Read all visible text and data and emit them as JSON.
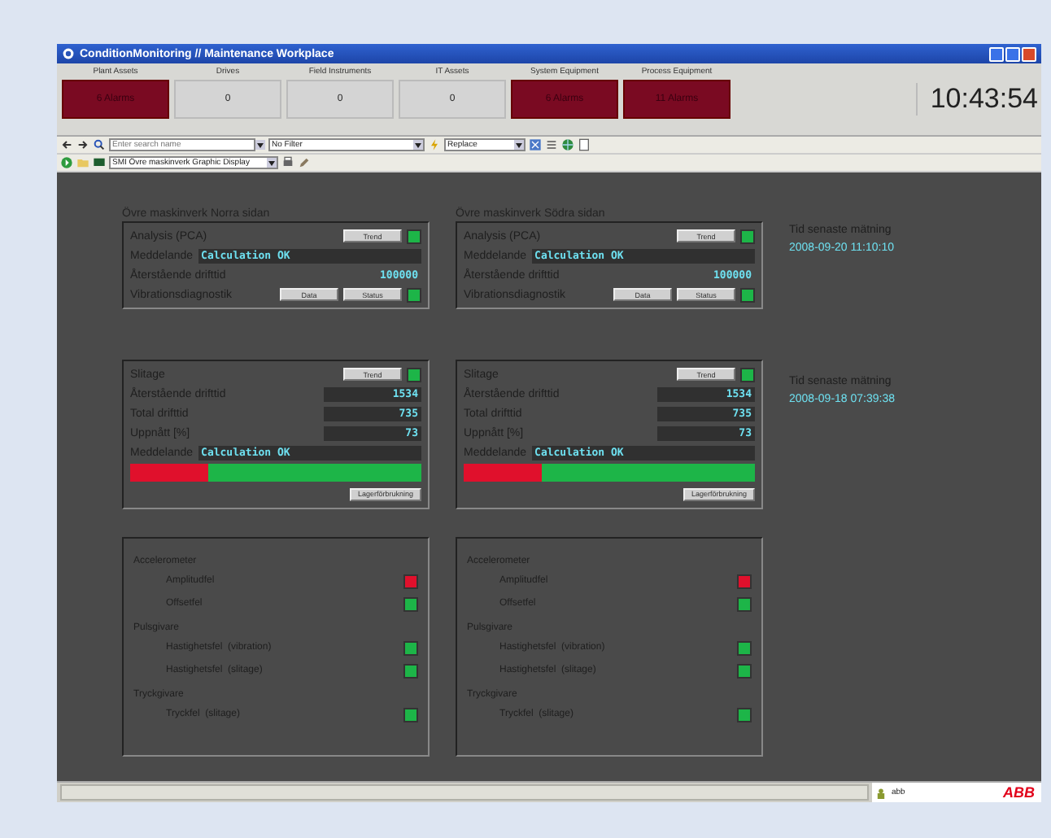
{
  "window": {
    "title": "ConditionMonitoring // Maintenance Workplace"
  },
  "categories": [
    {
      "label": "Plant Assets",
      "value": "6 Alarms",
      "alarm": true
    },
    {
      "label": "Drives",
      "value": "0",
      "alarm": false
    },
    {
      "label": "Field Instruments",
      "value": "0",
      "alarm": false
    },
    {
      "label": "IT Assets",
      "value": "0",
      "alarm": false
    },
    {
      "label": "System Equipment",
      "value": "6 Alarms",
      "alarm": true
    },
    {
      "label": "Process Equipment",
      "value": "11 Alarms",
      "alarm": true
    }
  ],
  "clock": "10:43:54",
  "toolbar": {
    "search_placeholder": "Enter search name",
    "filter": "No Filter",
    "mode": "Replace",
    "display": "SMI Övre maskinverk Graphic Display"
  },
  "sides": [
    {
      "title": "Övre maskinverk Norra sidan",
      "analysis_label": "Analysis (PCA)",
      "trend": "Trend",
      "analysis_ok": true,
      "message_label": "Meddelande",
      "message": "Calculation OK",
      "remaining_label": "Återstående drifttid",
      "remaining": "100000",
      "vibration_label": "Vibrationsdiagnostik",
      "data": "Data",
      "status": "Status",
      "vibration_ok": true,
      "wear": {
        "label": "Slitage",
        "trend": "Trend",
        "ok": true,
        "rows": [
          {
            "label": "Återstående drifttid",
            "value": "1534"
          },
          {
            "label": "Total drifttid",
            "value": "735"
          },
          {
            "label": "Uppnått [%]",
            "value": "73"
          }
        ],
        "message_label": "Meddelande",
        "message": "Calculation OK",
        "level": 0.27,
        "button": "Lagerförbrukning"
      },
      "sensors": [
        {
          "label": "Accelerometer",
          "children": [
            {
              "label": "Amplitudfel",
              "ok": false
            },
            {
              "label": "Offsetfel",
              "ok": true
            }
          ]
        },
        {
          "label": "Pulsgivare",
          "children": [
            {
              "label": "Hastighetsfel  (vibration)",
              "ok": true
            },
            {
              "label": "Hastighetsfel  (slitage)",
              "ok": true
            }
          ]
        },
        {
          "label": "Tryckgivare",
          "children": [
            {
              "label": "Tryckfel  (slitage)",
              "ok": true
            }
          ]
        }
      ]
    },
    {
      "title": "Övre maskinverk Södra sidan",
      "analysis_label": "Analysis (PCA)",
      "trend": "Trend",
      "analysis_ok": true,
      "message_label": "Meddelande",
      "message": "Calculation OK",
      "remaining_label": "Återstående drifttid",
      "remaining": "100000",
      "vibration_label": "Vibrationsdiagnostik",
      "data": "Data",
      "status": "Status",
      "vibration_ok": true,
      "wear": {
        "label": "Slitage",
        "trend": "Trend",
        "ok": true,
        "rows": [
          {
            "label": "Återstående drifttid",
            "value": "1534"
          },
          {
            "label": "Total drifttid",
            "value": "735"
          },
          {
            "label": "Uppnått [%]",
            "value": "73"
          }
        ],
        "message_label": "Meddelande",
        "message": "Calculation OK",
        "level": 0.27,
        "button": "Lagerförbrukning"
      },
      "sensors": [
        {
          "label": "Accelerometer",
          "children": [
            {
              "label": "Amplitudfel",
              "ok": false
            },
            {
              "label": "Offsetfel",
              "ok": true
            }
          ]
        },
        {
          "label": "Pulsgivare",
          "children": [
            {
              "label": "Hastighetsfel  (vibration)",
              "ok": true
            },
            {
              "label": "Hastighetsfel  (slitage)",
              "ok": true
            }
          ]
        },
        {
          "label": "Tryckgivare",
          "children": [
            {
              "label": "Tryckfel  (slitage)",
              "ok": true
            }
          ]
        }
      ]
    }
  ],
  "measurements": [
    {
      "label": "Tid senaste mätning",
      "time": "2008-09-20  11:10:10"
    },
    {
      "label": "Tid senaste mätning",
      "time": "2008-09-18  07:39:38"
    }
  ],
  "status_bar": {
    "user": "abb",
    "logo": "ABB"
  }
}
